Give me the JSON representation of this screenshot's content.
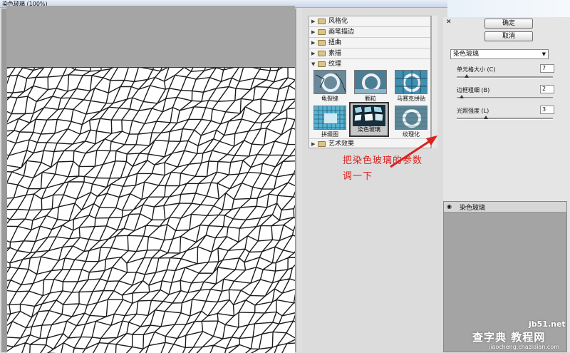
{
  "window": {
    "title": "染色玻璃 (100%)"
  },
  "filter_gallery": {
    "categories": [
      {
        "label": "风格化",
        "expanded": false
      },
      {
        "label": "画笔描边",
        "expanded": false
      },
      {
        "label": "扭曲",
        "expanded": false
      },
      {
        "label": "素描",
        "expanded": false
      },
      {
        "label": "纹理",
        "expanded": true
      },
      {
        "label": "艺术效果",
        "expanded": false
      }
    ],
    "texture_filters": [
      {
        "label": "龟裂缝"
      },
      {
        "label": "颗粒"
      },
      {
        "label": "马赛克拼贴"
      },
      {
        "label": "拼缀图"
      },
      {
        "label": "染色玻璃",
        "selected": true
      },
      {
        "label": "纹理化"
      }
    ]
  },
  "buttons": {
    "ok": "确定",
    "cancel": "取消"
  },
  "settings": {
    "filter_select": "染色玻璃",
    "params": [
      {
        "label": "单元格大小 (C)",
        "value": "7",
        "level": 0.1
      },
      {
        "label": "边框粗细 (B)",
        "value": "2",
        "level": 0.05
      },
      {
        "label": "光照强度 (L)",
        "value": "3",
        "level": 0.3
      }
    ]
  },
  "layers": {
    "items": [
      {
        "name": "染色玻璃",
        "visible": true
      }
    ]
  },
  "annotation": {
    "text": "把染色玻璃的参数调一下"
  },
  "watermark": {
    "line1": "jb51.net",
    "line2": "查字典 教程网",
    "line3": "jiaocheng.chazidian.com"
  },
  "icons": {
    "close": "close-icon",
    "eye": "eye-icon",
    "folder": "folder-icon",
    "expand": "triangle-right-icon",
    "collapse": "triangle-down-icon",
    "dropdown": "chevron-down-icon"
  }
}
